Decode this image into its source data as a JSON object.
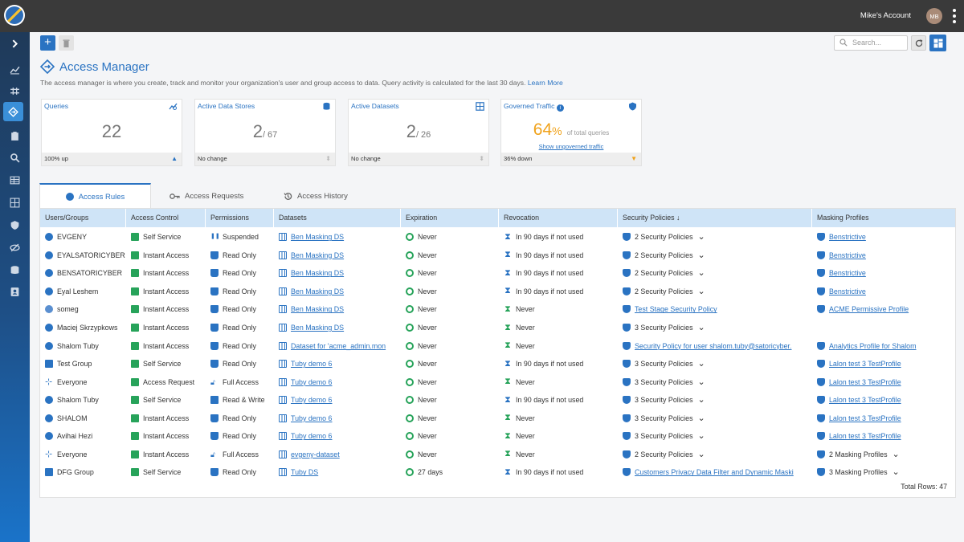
{
  "topbar": {
    "account": "Mike's Account",
    "avatar": "MB"
  },
  "toolbar": {
    "search_placeholder": "Search..."
  },
  "page": {
    "title": "Access Manager",
    "description": "The access manager is where you create, track and monitor your organization's user and group access to data. Query activity is calculated for the last 30 days.",
    "learn_more": "Learn More"
  },
  "cards": [
    {
      "title": "Queries",
      "value": "22",
      "footer": "100% up"
    },
    {
      "title": "Active Data Stores",
      "value": "2",
      "total": "/ 67",
      "footer": "No change"
    },
    {
      "title": "Active Datasets",
      "value": "2",
      "total": "/ 26",
      "footer": "No change"
    },
    {
      "title": "Governed Traffic",
      "value": "64",
      "unit": "%",
      "label": "of total queries",
      "link": "Show ungoverned traffic",
      "footer": "36% down"
    }
  ],
  "tabs": [
    {
      "label": "Access Rules"
    },
    {
      "label": "Access Requests"
    },
    {
      "label": "Access History"
    }
  ],
  "table": {
    "headers": [
      "Users/Groups",
      "Access Control",
      "Permissions",
      "Datasets",
      "Expiration",
      "Revocation",
      "Security Policies",
      "Masking Profiles"
    ],
    "rows": [
      [
        "EVGENY",
        "Self Service",
        "Suspended",
        "Ben Masking DS",
        "Never",
        "In 90 days if not used",
        "2 Security Policies",
        "Benstrictive"
      ],
      [
        "EYALSATORICYBER",
        "Instant Access",
        "Read Only",
        "Ben Masking DS",
        "Never",
        "In 90 days if not used",
        "2 Security Policies",
        "Benstrictive"
      ],
      [
        "BENSATORICYBER",
        "Instant Access",
        "Read Only",
        "Ben Masking DS",
        "Never",
        "In 90 days if not used",
        "2 Security Policies",
        "Benstrictive"
      ],
      [
        "Eyal Leshem",
        "Instant Access",
        "Read Only",
        "Ben Masking DS",
        "Never",
        "In 90 days if not used",
        "2 Security Policies",
        "Benstrictive"
      ],
      [
        "someg",
        "Instant Access",
        "Read Only",
        "Ben Masking DS",
        "Never",
        "Never",
        "Test Stage Security Policy",
        "ACME Permissive Profile"
      ],
      [
        "Maciej Skrzypkows",
        "Instant Access",
        "Read Only",
        "Ben Masking DS",
        "Never",
        "Never",
        "3 Security Policies",
        ""
      ],
      [
        "Shalom Tuby",
        "Instant Access",
        "Read Only",
        "Dataset for 'acme_admin.mon",
        "Never",
        "Never",
        "Security Policy for user shalom.tuby@satoricyber.",
        "Analytics Profile for Shalom"
      ],
      [
        "Test Group",
        "Self Service",
        "Read Only",
        "Tuby demo 6",
        "Never",
        "In 90 days if not used",
        "3 Security Policies",
        "Lalon test 3 TestProfile"
      ],
      [
        "Everyone",
        "Access Request",
        "Full Access",
        "Tuby demo 6",
        "Never",
        "Never",
        "3 Security Policies",
        "Lalon test 3 TestProfile"
      ],
      [
        "Shalom Tuby",
        "Self Service",
        "Read & Write",
        "Tuby demo 6",
        "Never",
        "In 90 days if not used",
        "3 Security Policies",
        "Lalon test 3 TestProfile"
      ],
      [
        "SHALOM",
        "Instant Access",
        "Read Only",
        "Tuby demo 6",
        "Never",
        "Never",
        "3 Security Policies",
        "Lalon test 3 TestProfile"
      ],
      [
        "Avihai Hezi",
        "Instant Access",
        "Read Only",
        "Tuby demo 6",
        "Never",
        "Never",
        "3 Security Policies",
        "Lalon test 3 TestProfile"
      ],
      [
        "Everyone",
        "Instant Access",
        "Full Access",
        "evgeny-dataset",
        "Never",
        "Never",
        "2 Security Policies",
        "2 Masking Profiles"
      ],
      [
        "DFG Group",
        "Self Service",
        "Read Only",
        "Tuby DS",
        "27 days",
        "In 90 days if not used",
        "Customers Privacy Data Filter and Dynamic Maski",
        "3 Masking Profiles"
      ]
    ],
    "total_rows": "Total Rows: 47"
  }
}
